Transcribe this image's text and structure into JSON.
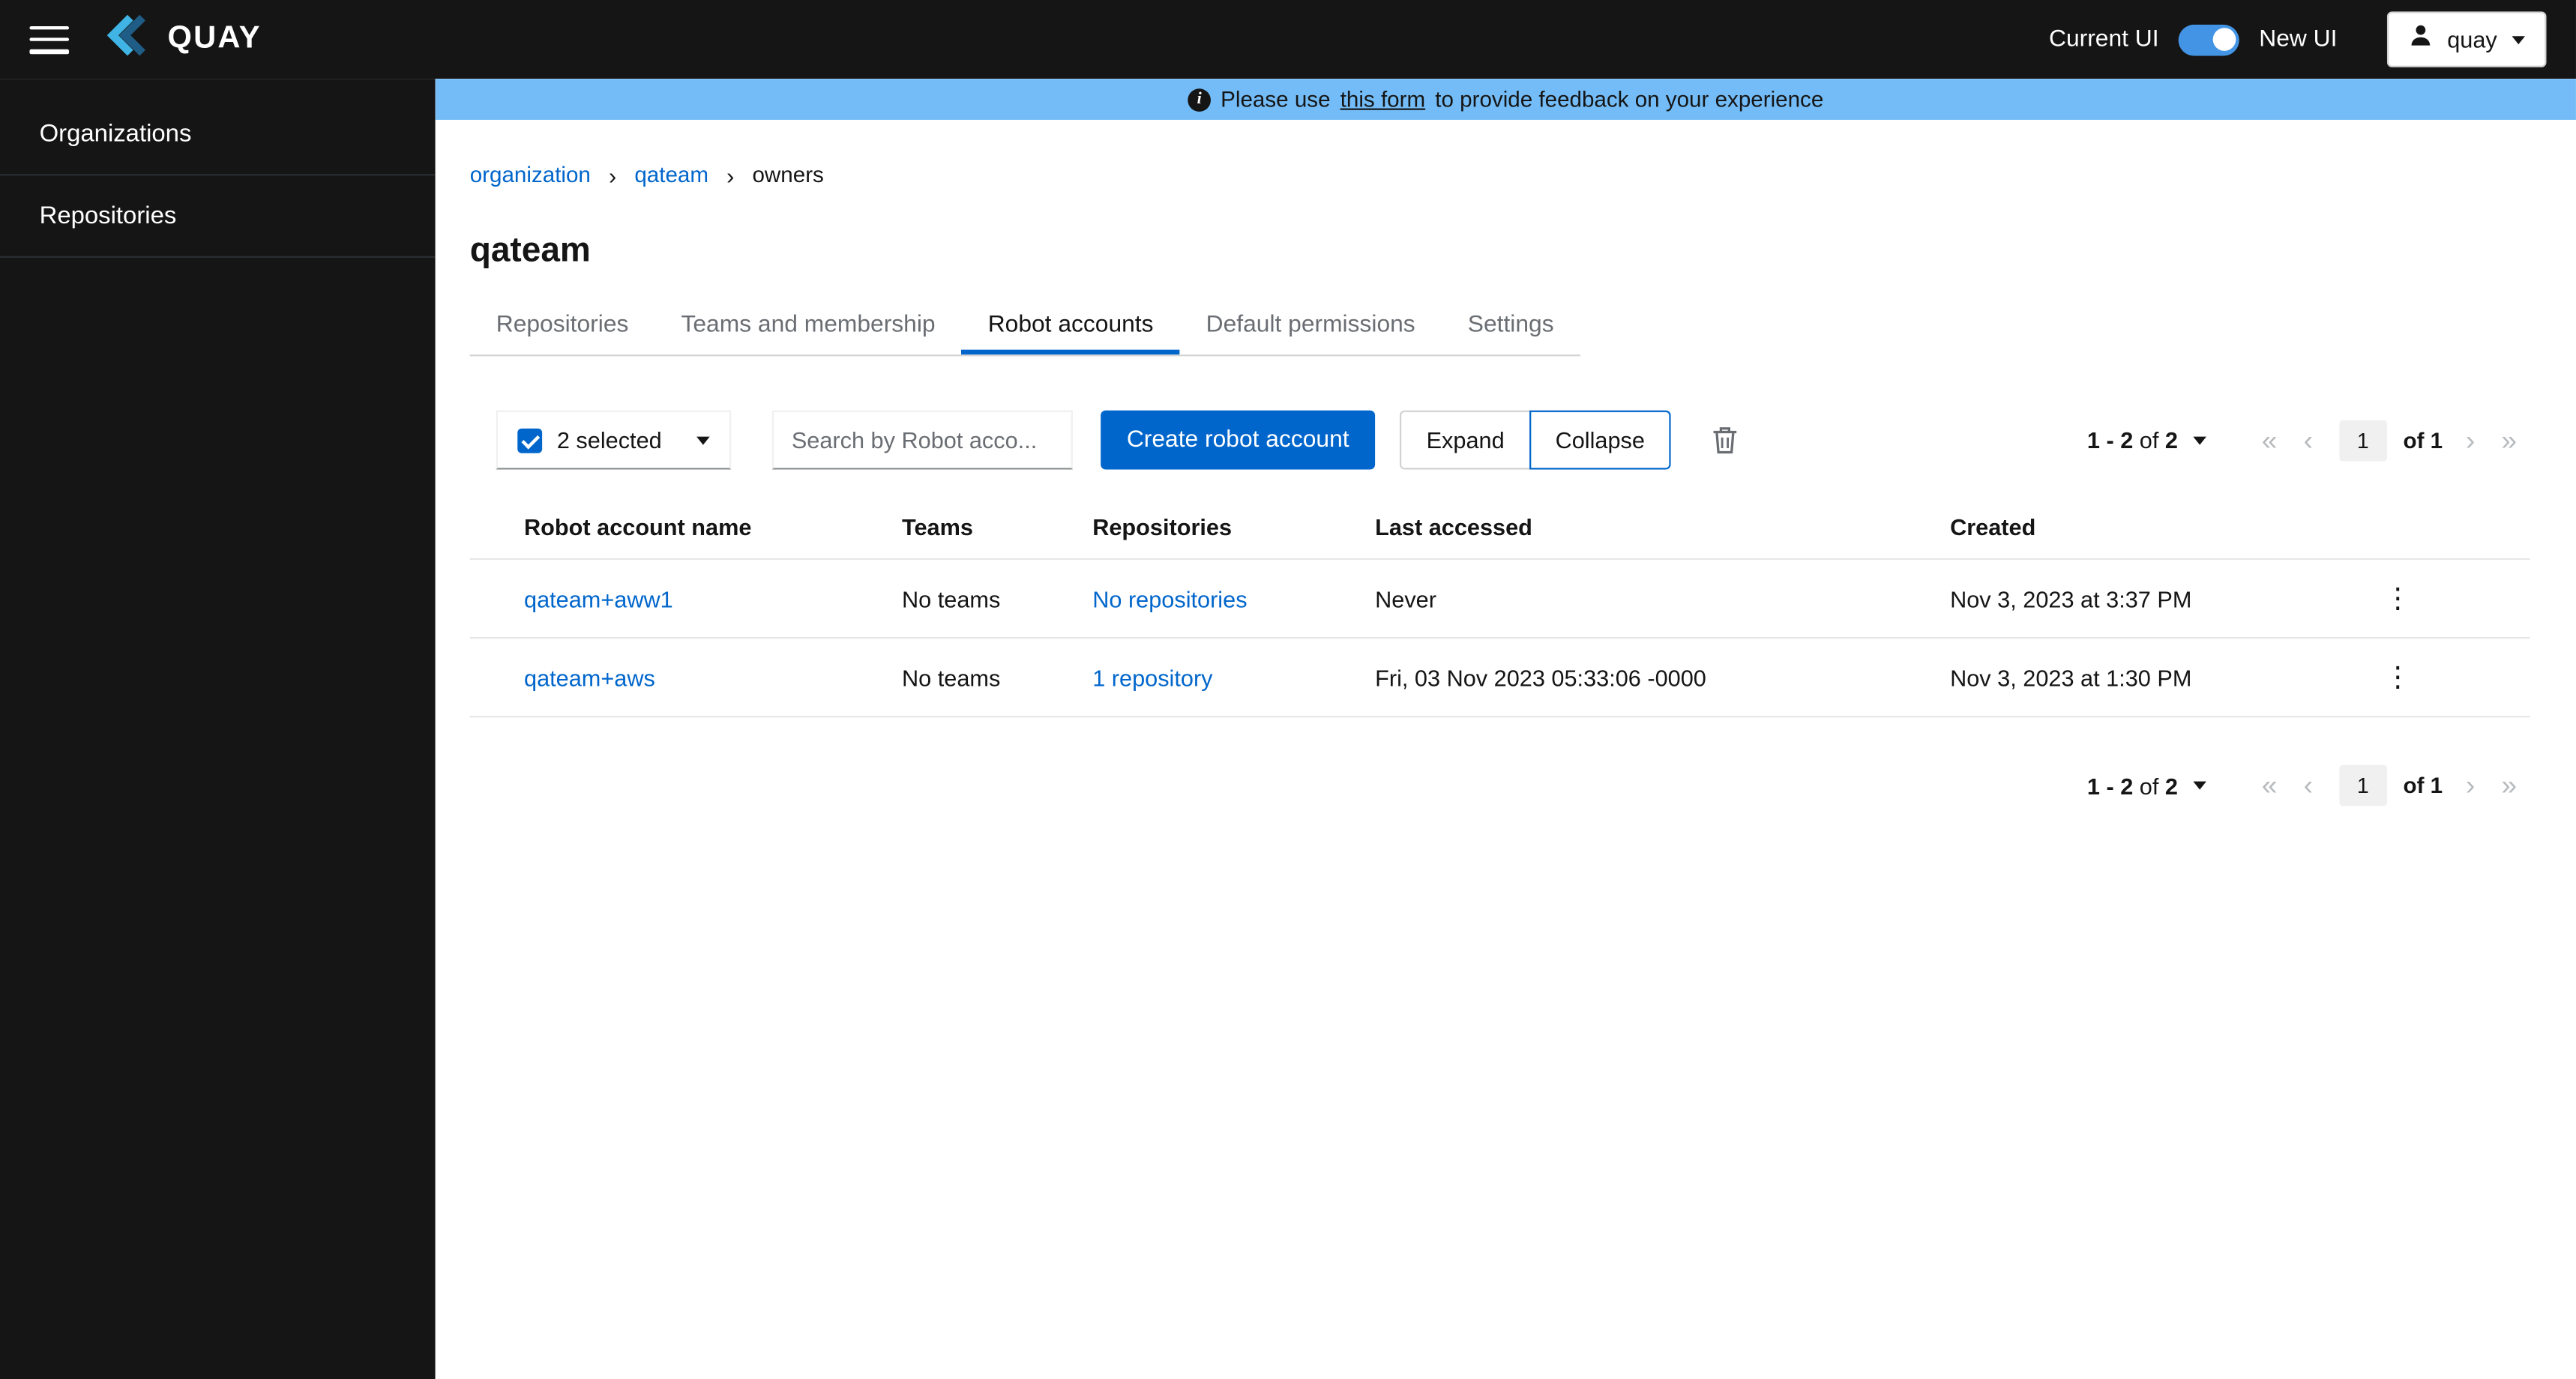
{
  "header": {
    "brand": "QUAY",
    "ui_toggle": {
      "current_label": "Current UI",
      "new_label": "New UI"
    },
    "user": {
      "name": "quay"
    }
  },
  "sidebar": {
    "items": [
      {
        "label": "Organizations"
      },
      {
        "label": "Repositories"
      }
    ]
  },
  "banner": {
    "text_before_link": "Please use",
    "link_text": "this form",
    "text_after_link": "to provide feedback on your experience"
  },
  "breadcrumb": {
    "items": [
      {
        "label": "organization"
      },
      {
        "label": "qateam"
      },
      {
        "label": "owners"
      }
    ]
  },
  "page": {
    "title": "qateam"
  },
  "tabs": {
    "items": [
      {
        "label": "Repositories"
      },
      {
        "label": "Teams and membership"
      },
      {
        "label": "Robot accounts"
      },
      {
        "label": "Default permissions"
      },
      {
        "label": "Settings"
      }
    ],
    "active": "Robot accounts"
  },
  "toolbar": {
    "bulk_select_label": "2 selected",
    "search_placeholder": "Search by Robot acco...",
    "create_button_label": "Create robot account",
    "expand_label": "Expand",
    "collapse_label": "Collapse"
  },
  "pagination": {
    "range_first_last": "1 - 2",
    "range_of": "of",
    "range_total": "2",
    "current_page": "1",
    "of_label": "of 1"
  },
  "table": {
    "headers": {
      "name": "Robot account name",
      "teams": "Teams",
      "repositories": "Repositories",
      "last_accessed": "Last accessed",
      "created": "Created"
    },
    "rows": [
      {
        "name": "qateam+aww1",
        "teams": "No teams",
        "repositories": "No repositories",
        "last_accessed": "Never",
        "created": "Nov 3, 2023 at 3:37 PM"
      },
      {
        "name": "qateam+aws",
        "teams": "No teams",
        "repositories": "1 repository",
        "last_accessed": "Fri, 03 Nov 2023 05:33:06 -0000",
        "created": "Nov 3, 2023 at 1:30 PM"
      }
    ]
  },
  "icons": {
    "first": "«",
    "prev": "‹",
    "next": "›",
    "last": "»",
    "kebab": "⋮",
    "info": "i"
  },
  "colors": {
    "accent": "#0066cc",
    "link": "#0066cc",
    "header_bg": "#151515",
    "sidebar_bg": "#151515",
    "banner_bg": "#73bcf7",
    "toggle_on": "#4394e5",
    "muted": "#6a6e73",
    "border": "#d2d2d2",
    "row_border": "#e7e7e7",
    "page_box_bg": "#f0f0f0"
  }
}
